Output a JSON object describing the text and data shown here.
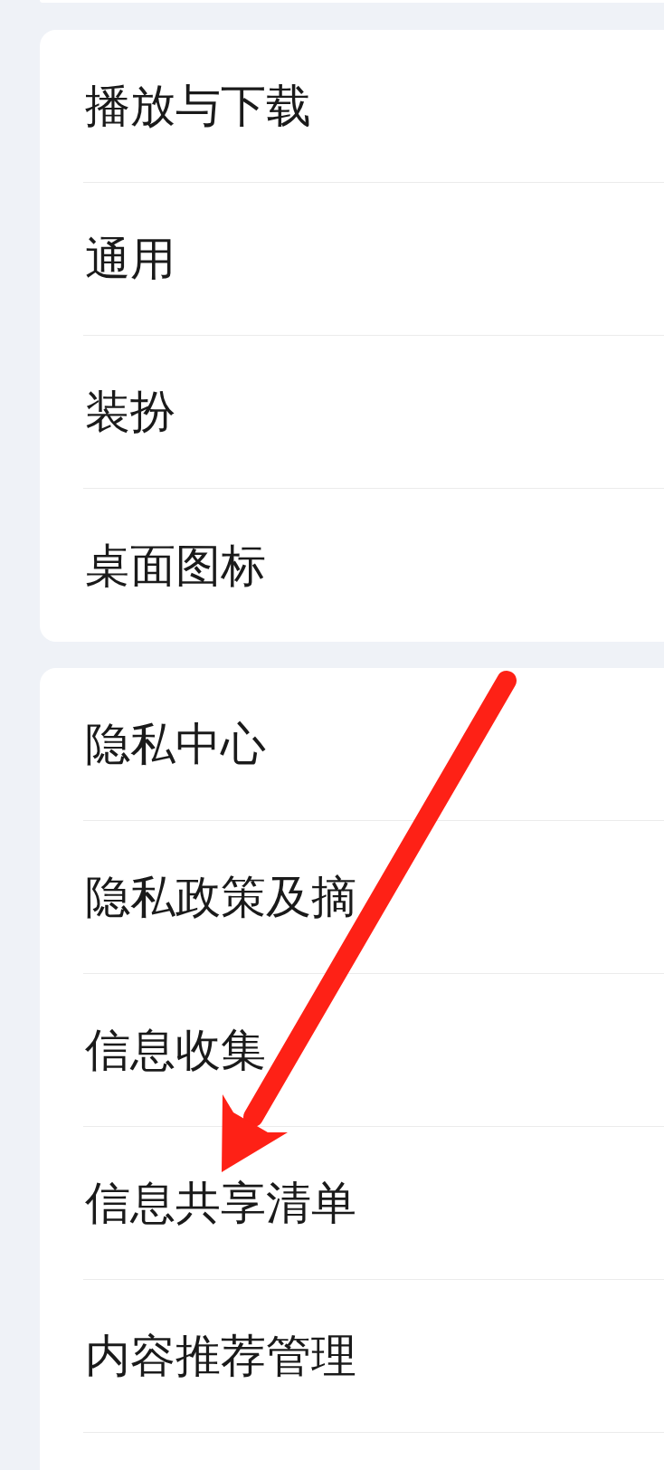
{
  "sections": [
    {
      "truncated": false,
      "items": [
        {
          "label": "播放与下载"
        },
        {
          "label": "通用"
        },
        {
          "label": "装扮"
        },
        {
          "label": "桌面图标"
        }
      ]
    },
    {
      "truncated": true,
      "items": [
        {
          "label": "隐私中心"
        },
        {
          "label": "隐私政策及摘"
        },
        {
          "label": "信息收集"
        },
        {
          "label": "信息共享清单"
        },
        {
          "label": "内容推荐管理"
        }
      ]
    }
  ]
}
